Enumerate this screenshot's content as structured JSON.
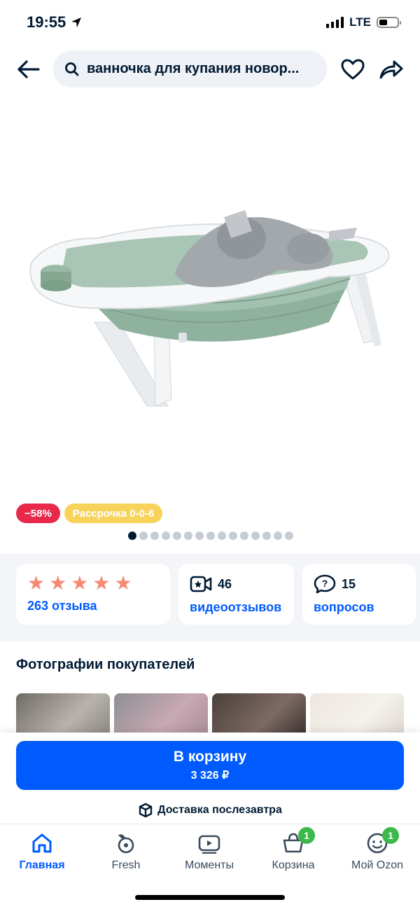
{
  "status_bar": {
    "time": "19:55",
    "network": "LTE"
  },
  "search": {
    "query": "ванночка для купания новор..."
  },
  "badges": {
    "discount": "−58%",
    "installment": "Рассрочка 0-0-6"
  },
  "gallery": {
    "dot_count": 15,
    "active_index": 0
  },
  "stats": {
    "rating_stars": 5,
    "reviews_label": "263 отзыва",
    "video_count": "46",
    "video_label": "видеоотзывов",
    "questions_count": "15",
    "questions_label": "вопросов"
  },
  "photos": {
    "title": "Фотографии покупателей"
  },
  "cart": {
    "button_label": "В корзину",
    "price": "3 326 ₽",
    "delivery": "Доставка послезавтра"
  },
  "tabs": [
    {
      "label": "Главная",
      "icon": "home-icon",
      "active": true
    },
    {
      "label": "Fresh",
      "icon": "fresh-icon"
    },
    {
      "label": "Моменты",
      "icon": "moments-icon"
    },
    {
      "label": "Корзина",
      "icon": "cart-icon",
      "badge": "1"
    },
    {
      "label": "Мой Ozon",
      "icon": "profile-icon",
      "badge": "1"
    }
  ],
  "colors": {
    "accent": "#005bff",
    "discount": "#e8294c",
    "installment": "#f7d35c",
    "star": "#f58a73",
    "badge_green": "#3cb94a"
  }
}
